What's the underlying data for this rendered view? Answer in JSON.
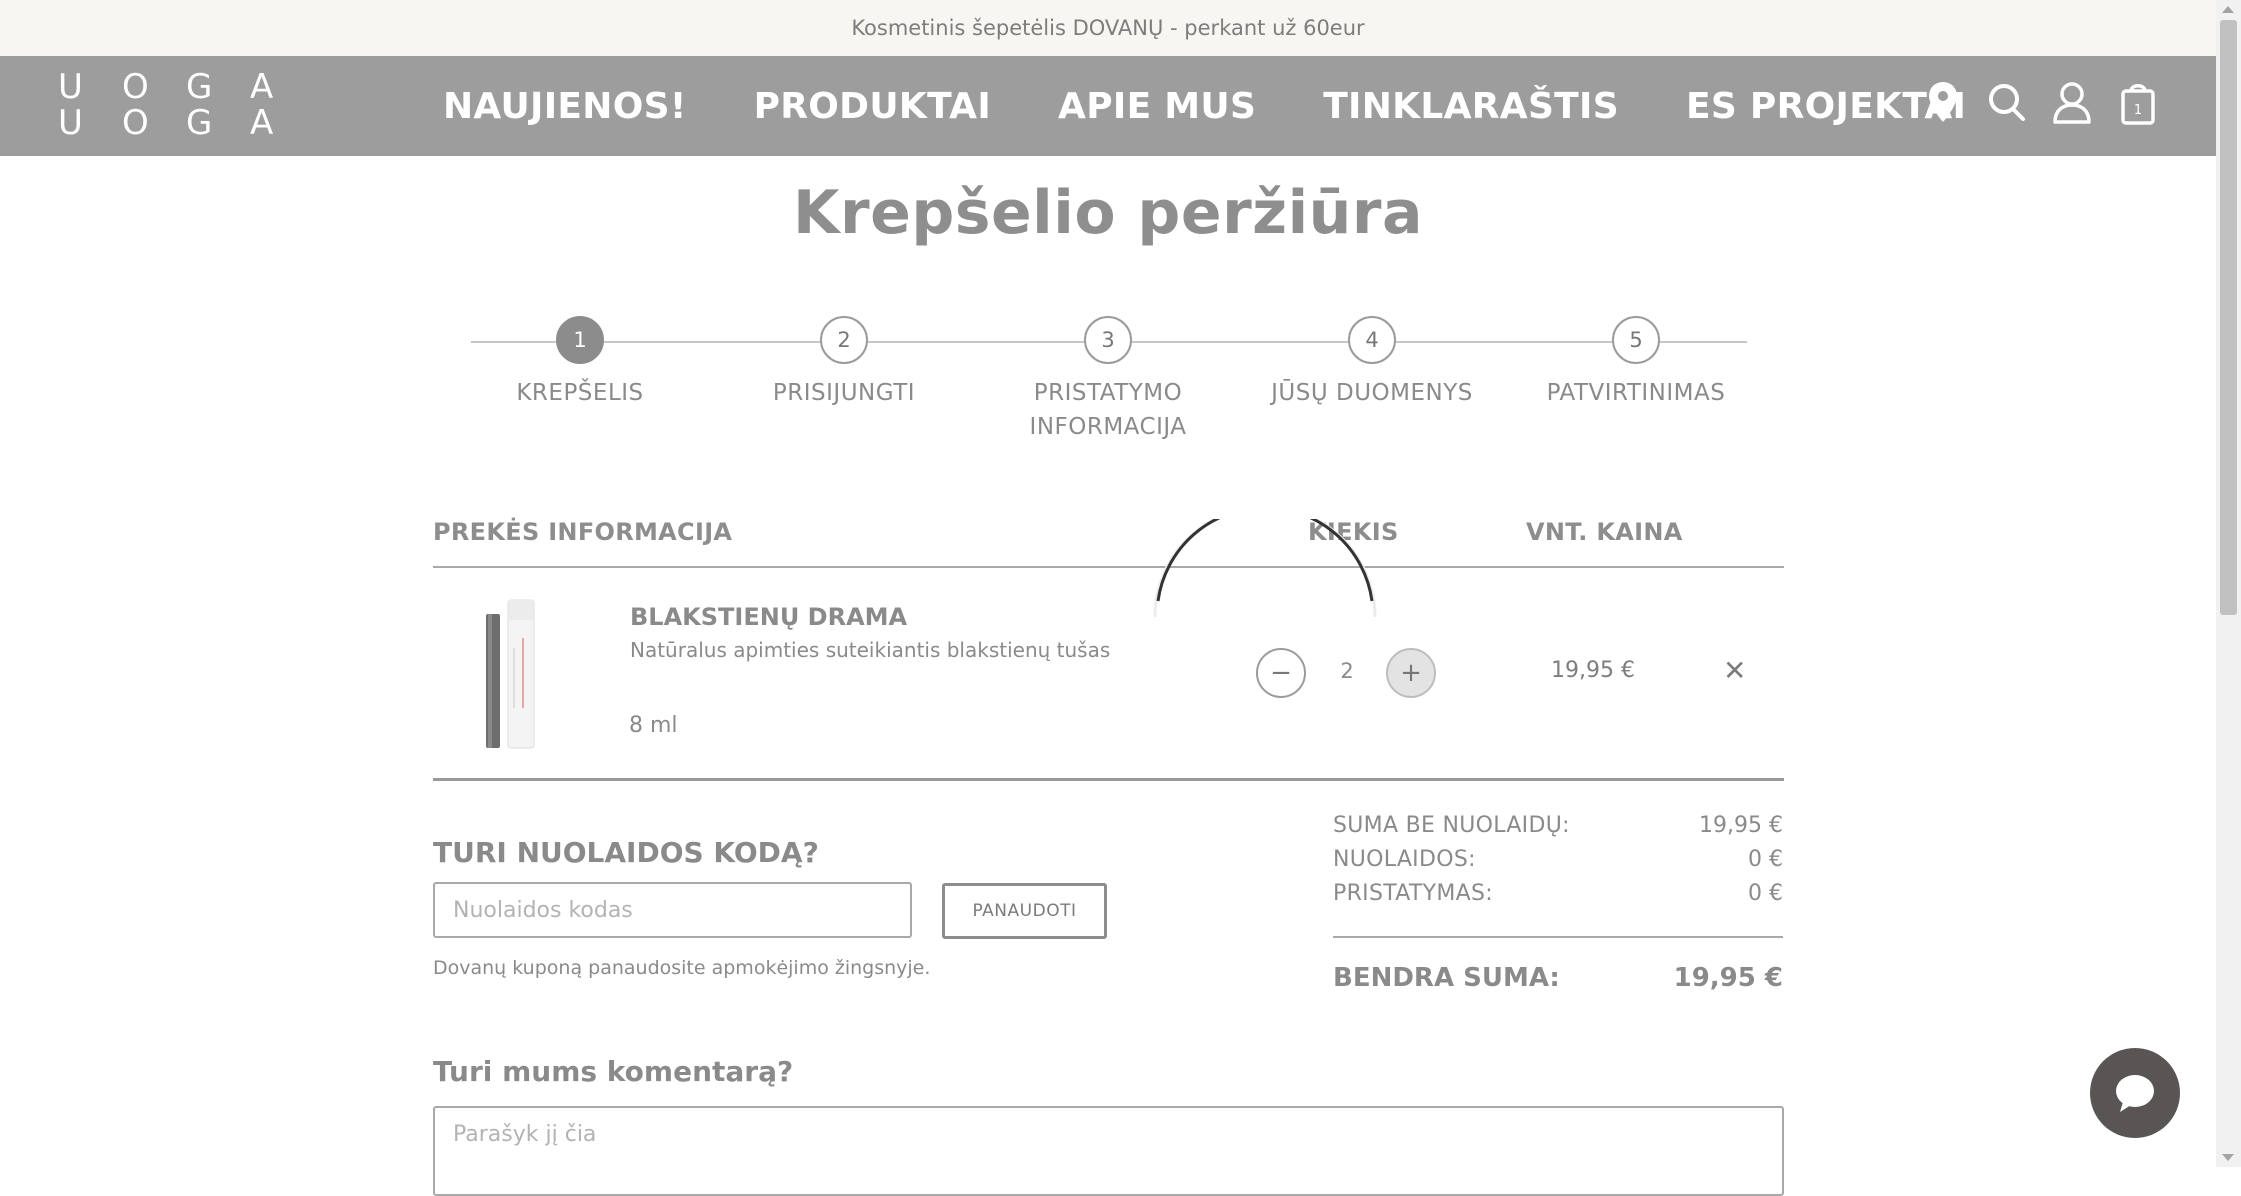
{
  "promo_banner": "Kosmetinis šepetėlis DOVANŲ - perkant už 60eur",
  "header": {
    "logo_letters": [
      "U",
      "O",
      "G",
      "A",
      "U",
      "O",
      "G",
      "A"
    ],
    "menu": [
      "NAUJIENOS!",
      "PRODUKTAI",
      "APIE MUS",
      "TINKLARAŠTIS",
      "ES PROJEKTAI"
    ],
    "icons": [
      "location-pin-icon",
      "search-icon",
      "user-icon",
      "cart-icon"
    ],
    "cart_count": "1"
  },
  "page_title": "Krepšelio peržiūra",
  "steps": [
    {
      "number": "1",
      "label": "KREPŠELIS",
      "active": true
    },
    {
      "number": "2",
      "label": "PRISIJUNGTI",
      "active": false
    },
    {
      "number": "3",
      "label": "PRISTATYMO INFORMACIJA",
      "active": false
    },
    {
      "number": "4",
      "label": "JŪSŲ DUOMENYS",
      "active": false
    },
    {
      "number": "5",
      "label": "PATVIRTINIMAS",
      "active": false
    }
  ],
  "table": {
    "headers": {
      "product": "PREKĖS INFORMACIJA",
      "quantity": "KIEKIS",
      "unit_price": "VNT. KAINA"
    },
    "items": [
      {
        "name": "BLAKSTIENŲ DRAMA",
        "description": "Natūralus apimties suteikiantis blakstienų tušas",
        "size": "8 ml",
        "quantity": "2",
        "unit_price": "19,95 €"
      }
    ]
  },
  "discount": {
    "title": "TURI NUOLAIDOS KODĄ?",
    "placeholder": "Nuolaidos kodas",
    "button": "PANAUDOTI",
    "note": "Dovanų kuponą panaudosite apmokėjimo žingsnyje."
  },
  "summary": {
    "rows": [
      {
        "label": "SUMA BE NUOLAIDŲ:",
        "value": "19,95 €"
      },
      {
        "label": "NUOLAIDOS:",
        "value": "0 €"
      },
      {
        "label": "PRISTATYMAS:",
        "value": "0 €"
      }
    ],
    "total_label": "BENDRA SUMA:",
    "total_value": "19,95 €"
  },
  "comment": {
    "title": "Turi mums komentarą?",
    "placeholder": "Parašyk jį čia"
  },
  "colors": {
    "nav_bg": "#9d9d9d",
    "promo_bg": "#f8f6f1",
    "text_gray": "#8a8a8a",
    "chat_bg": "#5a5555"
  }
}
